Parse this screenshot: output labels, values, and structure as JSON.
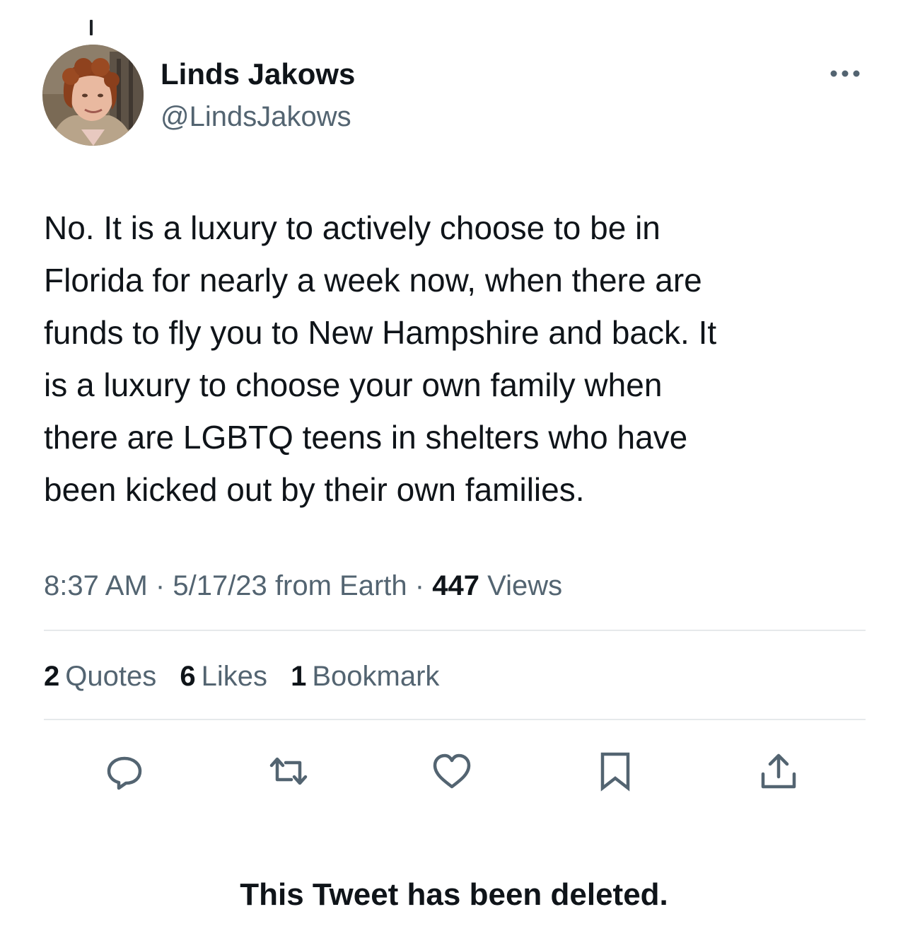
{
  "author": {
    "display_name": "Linds Jakows",
    "handle": "@LindsJakows",
    "avatar_icon": "profile-photo",
    "more_icon": "more-horizontal-icon"
  },
  "tweet": {
    "text_lines": [
      "No. It is a luxury to actively choose to be in",
      "Florida for nearly a week now, when there are",
      "funds to fly you to New Hampshire and back. It",
      "is a luxury to choose your own family when",
      "there are LGBTQ teens in shelters who have",
      "been kicked out by their own families."
    ],
    "time": "8:37 AM",
    "date": "5/17/23",
    "source": "from Earth",
    "separator": "·",
    "views_count": "447",
    "views_label": "Views"
  },
  "stats": {
    "quotes_count": "2",
    "quotes_label": "Quotes",
    "likes_count": "6",
    "likes_label": "Likes",
    "bookmarks_count": "1",
    "bookmarks_label": "Bookmark"
  },
  "actions": [
    {
      "icon": "reply-icon"
    },
    {
      "icon": "retweet-icon"
    },
    {
      "icon": "like-icon"
    },
    {
      "icon": "bookmark-icon"
    },
    {
      "icon": "share-icon"
    }
  ],
  "notice": {
    "text": "This Tweet has been deleted."
  },
  "colors": {
    "text_primary": "#0f1419",
    "text_secondary": "#536471",
    "divider": "#e6e9eb"
  }
}
